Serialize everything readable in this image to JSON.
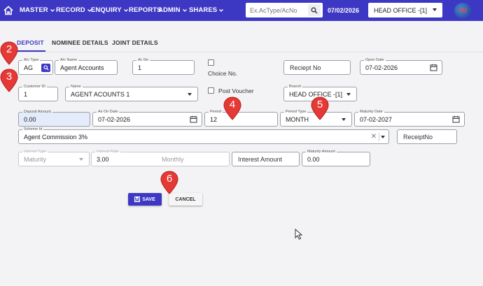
{
  "nav": {
    "menus": [
      {
        "label": "MASTER",
        "dropdown": true
      },
      {
        "label": "RECORD",
        "dropdown": true
      },
      {
        "label": "ENQUIRY",
        "dropdown": true
      },
      {
        "label": "REPORTS",
        "dropdown": false
      },
      {
        "label": "ADMIN",
        "dropdown": true
      },
      {
        "label": "SHARES",
        "dropdown": true
      }
    ],
    "search_placeholder": "Ex.AcType/AcNo",
    "date": "07/02/2026",
    "branch": "HEAD OFFICE -[1]",
    "logo_text": "TM"
  },
  "tabs": [
    "DEPOSIT",
    "NOMINEE DETAILS",
    "JOINT DETAILS"
  ],
  "form": {
    "ac_type": {
      "label": "A/c Type",
      "value": "AG"
    },
    "ac_name": {
      "label": "A/c Name",
      "value": "Agent Accounts"
    },
    "ac_no": {
      "label": "Ac No",
      "value": "1"
    },
    "choice_no": {
      "label": "Choice No.",
      "checked": false
    },
    "receipt_no_1": {
      "placeholder": "Reciept No"
    },
    "open_date": {
      "label": "Open Date",
      "value": "07-02-2026"
    },
    "customer_id": {
      "label": "Customer ID",
      "value": "1"
    },
    "name": {
      "label": "Name",
      "value": "AGENT ACOUNTS 1"
    },
    "post_voucher": {
      "label": "Post Voucher",
      "checked": false
    },
    "branch": {
      "label": "Branch",
      "value": "HEAD OFFICE -[1]"
    },
    "deposit_amount": {
      "label": "Deposit Amount",
      "value": "0.00"
    },
    "as_on_date": {
      "label": "As On Date",
      "value": "07-02-2026"
    },
    "period": {
      "label": "Period",
      "value": "12"
    },
    "period_type": {
      "label": "Period Type",
      "value": "MONTH"
    },
    "maturity_date": {
      "label": "Maturity Date",
      "value": "07-02-2027"
    },
    "scheme_id": {
      "label": "Scheme Id",
      "value": "Agent Commission 3%"
    },
    "receipt_no_2": {
      "placeholder": "ReceiptNo"
    },
    "interest_type": {
      "label": "Interest Type",
      "value": "Maturity"
    },
    "interest_rate": {
      "label": "Interest Rate",
      "value": "3.00",
      "suffix": "Monthly"
    },
    "interest_amount": {
      "placeholder": "Interest Amount"
    },
    "maturity_amount": {
      "label": "Maturity Amount",
      "value": "0.00"
    }
  },
  "buttons": {
    "save": "SAVE",
    "cancel": "CANCEL"
  },
  "markers": [
    "2",
    "3",
    "4",
    "5",
    "6"
  ],
  "colors": {
    "primary": "#3d38c4",
    "marker": "#e53935",
    "background": "#f3f3f5"
  }
}
